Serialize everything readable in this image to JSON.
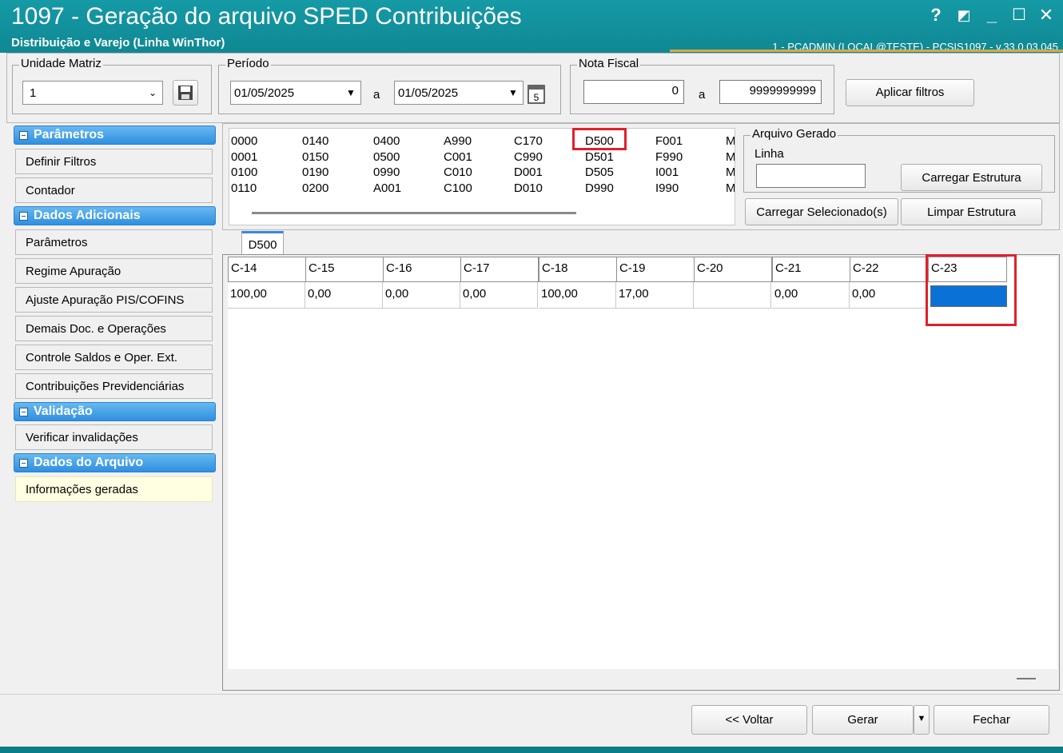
{
  "window": {
    "title": "1097 - Geração do arquivo SPED Contribuições",
    "subtitle": "Distribuição e Varejo (Linha WinThor)",
    "user_info": "1 - PCADMIN (LOCAL@TESTE) - PCSIS1097 - v.33.0.03.045",
    "controls": [
      "?",
      "◩",
      "_",
      "☐",
      "✕"
    ]
  },
  "filters": {
    "unidade_matriz": {
      "label": "Unidade Matriz",
      "value": "1"
    },
    "periodo": {
      "label": "Período",
      "start": "01/05/2025",
      "sep": "a",
      "end": "01/05/2025"
    },
    "nota_fiscal": {
      "label": "Nota Fiscal",
      "start": "0",
      "sep": "a",
      "end": "9999999999"
    },
    "apply_label": "Aplicar filtros"
  },
  "nav": {
    "groups": [
      {
        "title": "Parâmetros",
        "items": [
          "Definir Filtros",
          "Contador"
        ]
      },
      {
        "title": "Dados Adicionais",
        "items": [
          "Parâmetros",
          "Regime Apuração",
          "Ajuste Apuração PIS/COFINS",
          "Demais Doc. e Operações",
          "Controle Saldos e Oper. Ext.",
          "Contribuições Previdenciárias"
        ]
      },
      {
        "title": "Validação",
        "items": [
          "Verificar invalidações"
        ]
      },
      {
        "title": "Dados do Arquivo",
        "items": [
          "Informações geradas"
        ]
      }
    ]
  },
  "structure": {
    "columns": [
      [
        "0000",
        "0001",
        "0100",
        "0110"
      ],
      [
        "0140",
        "0150",
        "0190",
        "0200"
      ],
      [
        "0400",
        "0500",
        "0990",
        "A001"
      ],
      [
        "A990",
        "C001",
        "C010",
        "C100"
      ],
      [
        "C170",
        "C990",
        "D001",
        "D010"
      ],
      [
        "D500",
        "D501",
        "D505",
        "D990"
      ],
      [
        "F001",
        "F990",
        "I001",
        "I990"
      ],
      [
        "M",
        "M",
        "M",
        "M"
      ]
    ],
    "highlighted": "D500"
  },
  "arquivo_gerado": {
    "label": "Arquivo Gerado",
    "linha_label": "Linha",
    "linha_value": "",
    "carregar_estrutura": "Carregar Estrutura",
    "carregar_selecionados": "Carregar Selecionado(s)",
    "limpar_estrutura": "Limpar Estrutura"
  },
  "tab": {
    "label": "D500"
  },
  "grid": {
    "headers": [
      "C-14",
      "C-15",
      "C-16",
      "C-17",
      "C-18",
      "C-19",
      "C-20",
      "C-21",
      "C-22",
      "C-23"
    ],
    "rows": [
      [
        "100,00",
        "0,00",
        "0,00",
        "0,00",
        "100,00",
        "17,00",
        "",
        "0,00",
        "0,00",
        ""
      ]
    ],
    "selected_cell": "C-23"
  },
  "footer": {
    "voltar": "<< Voltar",
    "gerar": "Gerar",
    "fechar": "Fechar"
  },
  "colors": {
    "title_bg": "#159aa6",
    "nav_head": "#2f8fe0",
    "highlight": "#e0202a",
    "selected_cell": "#0a72d6"
  }
}
